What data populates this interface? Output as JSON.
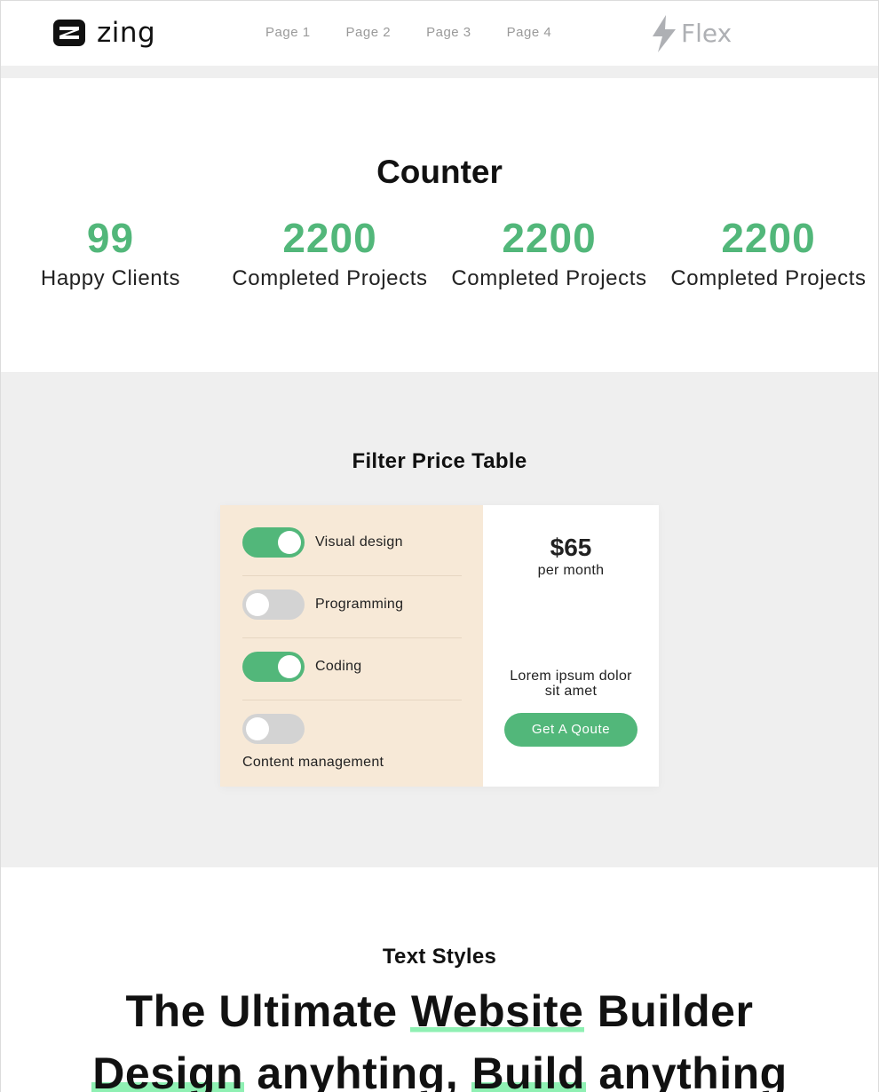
{
  "header": {
    "logo_text": "zing",
    "nav": [
      "Page 1",
      "Page 2",
      "Page 3",
      "Page 4"
    ],
    "brand_text": "Flex"
  },
  "counter": {
    "title": "Counter",
    "stats": [
      {
        "value": "99",
        "label": "Happy Clients"
      },
      {
        "value": "2200",
        "label": "Completed Projects"
      },
      {
        "value": "2200",
        "label": "Completed Projects"
      },
      {
        "value": "2200",
        "label": "Completed Projects"
      }
    ]
  },
  "price_table": {
    "title": "Filter Price Table",
    "features": [
      {
        "label": "Visual design",
        "enabled": true
      },
      {
        "label": "Programming",
        "enabled": false
      },
      {
        "label": "Coding",
        "enabled": true
      },
      {
        "label": "Content management",
        "enabled": false
      }
    ],
    "price": "$65",
    "period": "per month",
    "description": "Lorem ipsum dolor sit amet",
    "button_label": "Get A Qoute"
  },
  "text_styles": {
    "title": "Text Styles",
    "line1": {
      "before": "The Ultimate ",
      "highlight": "Website",
      "after": " Builder"
    },
    "line2": {
      "h1": "Design",
      "mid": " anyhting, ",
      "h2": "Build",
      "after": " anything"
    }
  },
  "colors": {
    "accent_green": "#52b77a",
    "highlight_green": "#8ff0b3",
    "feature_bg": "#f7e9d7",
    "section_gray": "#efefef"
  }
}
